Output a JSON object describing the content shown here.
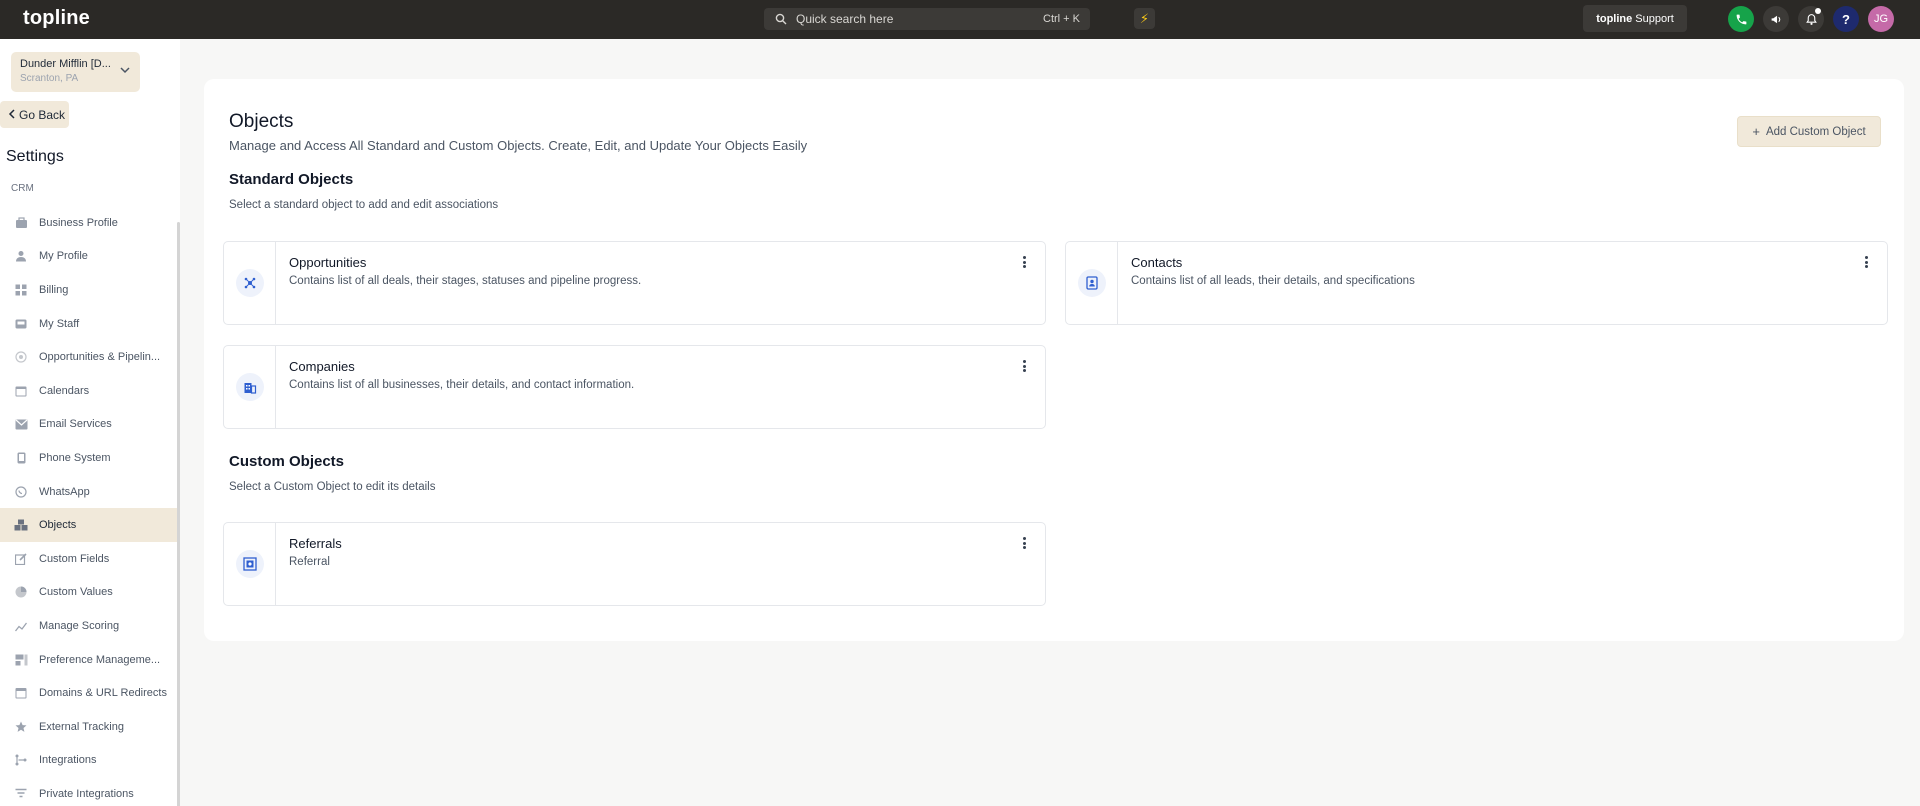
{
  "topbar": {
    "logo": "topline",
    "search_placeholder": "Quick search here",
    "search_shortcut": "Ctrl + K",
    "support_brand": "topline",
    "support_label": "Support",
    "avatar_initials": "JG"
  },
  "sidebar": {
    "location_name": "Dunder Mifflin [D...",
    "location_sub": "Scranton, PA",
    "go_back": "Go Back",
    "title": "Settings",
    "section": "CRM",
    "items": [
      {
        "label": "Business Profile",
        "icon": "briefcase-icon"
      },
      {
        "label": "My Profile",
        "icon": "user-icon"
      },
      {
        "label": "Billing",
        "icon": "grid-icon"
      },
      {
        "label": "My Staff",
        "icon": "inbox-icon"
      },
      {
        "label": "Opportunities & Pipelin...",
        "icon": "target-icon"
      },
      {
        "label": "Calendars",
        "icon": "calendar-icon"
      },
      {
        "label": "Email Services",
        "icon": "email-icon"
      },
      {
        "label": "Phone System",
        "icon": "phone-icon"
      },
      {
        "label": "WhatsApp",
        "icon": "whatsapp-icon"
      },
      {
        "label": "Objects",
        "icon": "objects-icon",
        "active": true
      },
      {
        "label": "Custom Fields",
        "icon": "edit-icon"
      },
      {
        "label": "Custom Values",
        "icon": "pie-icon"
      },
      {
        "label": "Manage Scoring",
        "icon": "chart-icon"
      },
      {
        "label": "Preference Manageme...",
        "icon": "preference-icon"
      },
      {
        "label": "Domains & URL Redirects",
        "icon": "store-icon"
      },
      {
        "label": "External Tracking",
        "icon": "star-icon"
      },
      {
        "label": "Integrations",
        "icon": "integration-icon"
      },
      {
        "label": "Private Integrations",
        "icon": "filter-icon"
      }
    ]
  },
  "main": {
    "title": "Objects",
    "subtitle": "Manage and Access All Standard and Custom Objects. Create, Edit, and Update Your Objects Easily",
    "add_button": "Add Custom Object",
    "standard": {
      "title": "Standard Objects",
      "subtitle": "Select a standard object to add and edit associations",
      "items": [
        {
          "name": "Opportunities",
          "desc": "Contains list of all deals, their stages, statuses and pipeline progress.",
          "icon": "opportunities-icon"
        },
        {
          "name": "Contacts",
          "desc": "Contains list of all leads, their details, and specifications",
          "icon": "contacts-icon"
        },
        {
          "name": "Companies",
          "desc": "Contains list of all businesses, their details, and contact information.",
          "icon": "companies-icon"
        }
      ]
    },
    "custom": {
      "title": "Custom Objects",
      "subtitle": "Select a Custom Object to edit its details",
      "items": [
        {
          "name": "Referrals",
          "desc": "Referral",
          "icon": "referrals-icon"
        }
      ]
    }
  },
  "colors": {
    "topbar_bg": "#2b2926",
    "accent_beige": "#f1e9da",
    "icon_blue": "#2f5fd0",
    "phone_green": "#16a34a"
  }
}
